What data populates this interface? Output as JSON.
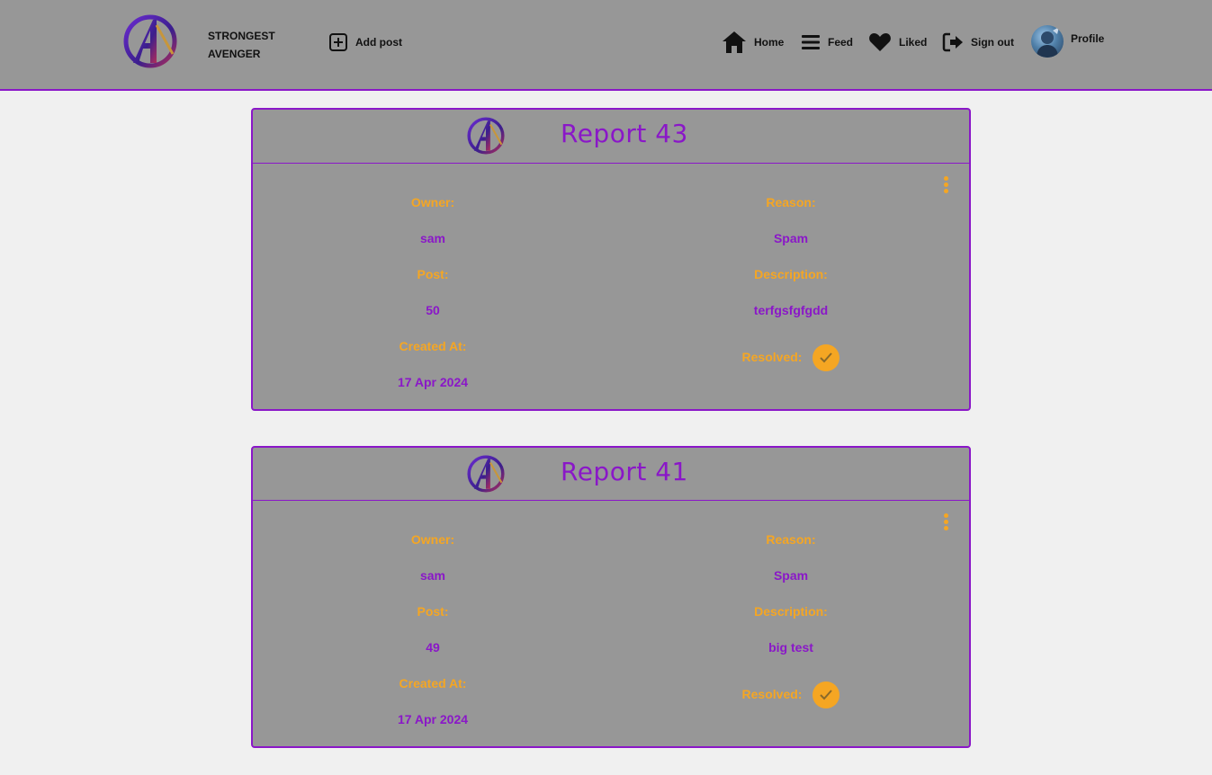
{
  "navbar": {
    "brand_line1": "STRONGEST",
    "brand_line2": "AVENGER",
    "add_post": "Add post",
    "home": "Home",
    "feed": "Feed",
    "liked": "Liked",
    "sign_out": "Sign out",
    "profile": "Profile"
  },
  "labels": {
    "owner": "Owner:",
    "post": "Post:",
    "created_at": "Created At:",
    "reason": "Reason:",
    "description": "Description:",
    "resolved": "Resolved:"
  },
  "reports": [
    {
      "title": "Report 43",
      "owner": "sam",
      "post": "50",
      "created_at": "17 Apr 2024",
      "reason": "Spam",
      "description": "terfgsfgfgdd",
      "resolved": true
    },
    {
      "title": "Report 41",
      "owner": "sam",
      "post": "49",
      "created_at": "17 Apr 2024",
      "reason": "Spam",
      "description": "big test",
      "resolved": true
    }
  ],
  "colors": {
    "accent_purple": "#8a17c8",
    "label_orange": "#f5a623",
    "card_gray": "#979797",
    "page_bg": "#f0f0f0"
  }
}
